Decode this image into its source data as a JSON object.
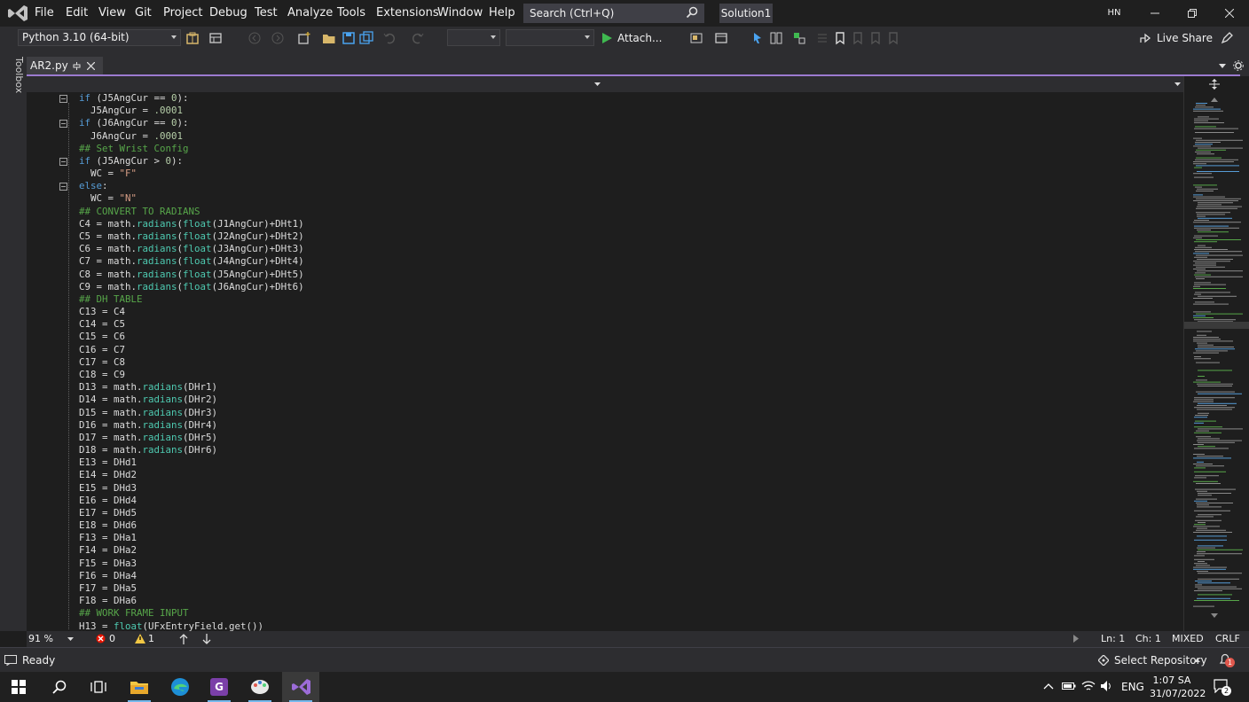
{
  "menubar": {
    "items": [
      "File",
      "Edit",
      "View",
      "Git",
      "Project",
      "Debug",
      "Test",
      "Analyze",
      "Tools",
      "Extensions",
      "Window",
      "Help"
    ],
    "search_placeholder": "Search (Ctrl+Q)",
    "solution": "Solution1",
    "user_initials": "HN"
  },
  "toolbar": {
    "interpreter": "Python 3.10 (64-bit)",
    "attach_label": "Attach...",
    "liveshare_label": "Live Share"
  },
  "toolbox_label": "Toolbox",
  "tab": {
    "filename": "AR2.py"
  },
  "code_lines": [
    [
      {
        "t": "if",
        "c": "k"
      },
      {
        "t": " (J5AngCur == "
      },
      {
        "t": "0",
        "c": "n"
      },
      {
        "t": "):"
      }
    ],
    [
      {
        "t": "  J5AngCur = "
      },
      {
        "t": ".0001",
        "c": "n"
      }
    ],
    [
      {
        "t": "if",
        "c": "k"
      },
      {
        "t": " (J6AngCur == "
      },
      {
        "t": "0",
        "c": "n"
      },
      {
        "t": "):"
      }
    ],
    [
      {
        "t": "  J6AngCur = "
      },
      {
        "t": ".0001",
        "c": "n"
      }
    ],
    [
      {
        "t": "## Set Wrist Config",
        "c": "c"
      }
    ],
    [
      {
        "t": "if",
        "c": "k"
      },
      {
        "t": " (J5AngCur > "
      },
      {
        "t": "0",
        "c": "n"
      },
      {
        "t": "):"
      }
    ],
    [
      {
        "t": "  WC = "
      },
      {
        "t": "\"F\"",
        "c": "s"
      }
    ],
    [
      {
        "t": "else",
        "c": "k"
      },
      {
        "t": ":"
      }
    ],
    [
      {
        "t": "  WC = "
      },
      {
        "t": "\"N\"",
        "c": "s"
      }
    ],
    [
      {
        "t": "## CONVERT TO RADIANS",
        "c": "c"
      }
    ],
    [
      {
        "t": "C4 = math."
      },
      {
        "t": "radians",
        "c": "f"
      },
      {
        "t": "("
      },
      {
        "t": "float",
        "c": "f"
      },
      {
        "t": "(J1AngCur)+DHt1)"
      }
    ],
    [
      {
        "t": "C5 = math."
      },
      {
        "t": "radians",
        "c": "f"
      },
      {
        "t": "("
      },
      {
        "t": "float",
        "c": "f"
      },
      {
        "t": "(J2AngCur)+DHt2)"
      }
    ],
    [
      {
        "t": "C6 = math."
      },
      {
        "t": "radians",
        "c": "f"
      },
      {
        "t": "("
      },
      {
        "t": "float",
        "c": "f"
      },
      {
        "t": "(J3AngCur)+DHt3)"
      }
    ],
    [
      {
        "t": "C7 = math."
      },
      {
        "t": "radians",
        "c": "f"
      },
      {
        "t": "("
      },
      {
        "t": "float",
        "c": "f"
      },
      {
        "t": "(J4AngCur)+DHt4)"
      }
    ],
    [
      {
        "t": "C8 = math."
      },
      {
        "t": "radians",
        "c": "f"
      },
      {
        "t": "("
      },
      {
        "t": "float",
        "c": "f"
      },
      {
        "t": "(J5AngCur)+DHt5)"
      }
    ],
    [
      {
        "t": "C9 = math."
      },
      {
        "t": "radians",
        "c": "f"
      },
      {
        "t": "("
      },
      {
        "t": "float",
        "c": "f"
      },
      {
        "t": "(J6AngCur)+DHt6)"
      }
    ],
    [
      {
        "t": "## DH TABLE",
        "c": "c"
      }
    ],
    [
      {
        "t": "C13 = C4"
      }
    ],
    [
      {
        "t": "C14 = C5"
      }
    ],
    [
      {
        "t": "C15 = C6"
      }
    ],
    [
      {
        "t": "C16 = C7"
      }
    ],
    [
      {
        "t": "C17 = C8"
      }
    ],
    [
      {
        "t": "C18 = C9"
      }
    ],
    [
      {
        "t": "D13 = math."
      },
      {
        "t": "radians",
        "c": "f"
      },
      {
        "t": "(DHr1)"
      }
    ],
    [
      {
        "t": "D14 = math."
      },
      {
        "t": "radians",
        "c": "f"
      },
      {
        "t": "(DHr2)"
      }
    ],
    [
      {
        "t": "D15 = math."
      },
      {
        "t": "radians",
        "c": "f"
      },
      {
        "t": "(DHr3)"
      }
    ],
    [
      {
        "t": "D16 = math."
      },
      {
        "t": "radians",
        "c": "f"
      },
      {
        "t": "(DHr4)"
      }
    ],
    [
      {
        "t": "D17 = math."
      },
      {
        "t": "radians",
        "c": "f"
      },
      {
        "t": "(DHr5)"
      }
    ],
    [
      {
        "t": "D18 = math."
      },
      {
        "t": "radians",
        "c": "f"
      },
      {
        "t": "(DHr6)"
      }
    ],
    [
      {
        "t": "E13 = DHd1"
      }
    ],
    [
      {
        "t": "E14 = DHd2"
      }
    ],
    [
      {
        "t": "E15 = DHd3"
      }
    ],
    [
      {
        "t": "E16 = DHd4"
      }
    ],
    [
      {
        "t": "E17 = DHd5"
      }
    ],
    [
      {
        "t": "E18 = DHd6"
      }
    ],
    [
      {
        "t": "F13 = DHa1"
      }
    ],
    [
      {
        "t": "F14 = DHa2"
      }
    ],
    [
      {
        "t": "F15 = DHa3"
      }
    ],
    [
      {
        "t": "F16 = DHa4"
      }
    ],
    [
      {
        "t": "F17 = DHa5"
      }
    ],
    [
      {
        "t": "F18 = DHa6"
      }
    ],
    [
      {
        "t": "## WORK FRAME INPUT",
        "c": "c"
      }
    ],
    [
      {
        "t": "H13 = "
      },
      {
        "t": "float",
        "c": "f"
      },
      {
        "t": "(UFxEntryField.get())"
      }
    ]
  ],
  "editor_status": {
    "zoom": "91 %",
    "errors": "0",
    "warnings": "1",
    "line": "Ln: 1",
    "col": "Ch: 1",
    "whitespace": "MIXED",
    "line_ending": "CRLF"
  },
  "app_status": {
    "ready": "Ready",
    "repo": "Select Repository",
    "notifications": "1"
  },
  "taskbar": {
    "lang": "ENG",
    "time": "1:07 SA",
    "date": "31/07/2022",
    "notif_count": "2"
  },
  "colors": {
    "accent": "#9c7bd0",
    "keyword": "#569cd6",
    "comment": "#57a64a",
    "string": "#d69d85",
    "number": "#b5cea8",
    "builtin": "#4ec9b0"
  }
}
